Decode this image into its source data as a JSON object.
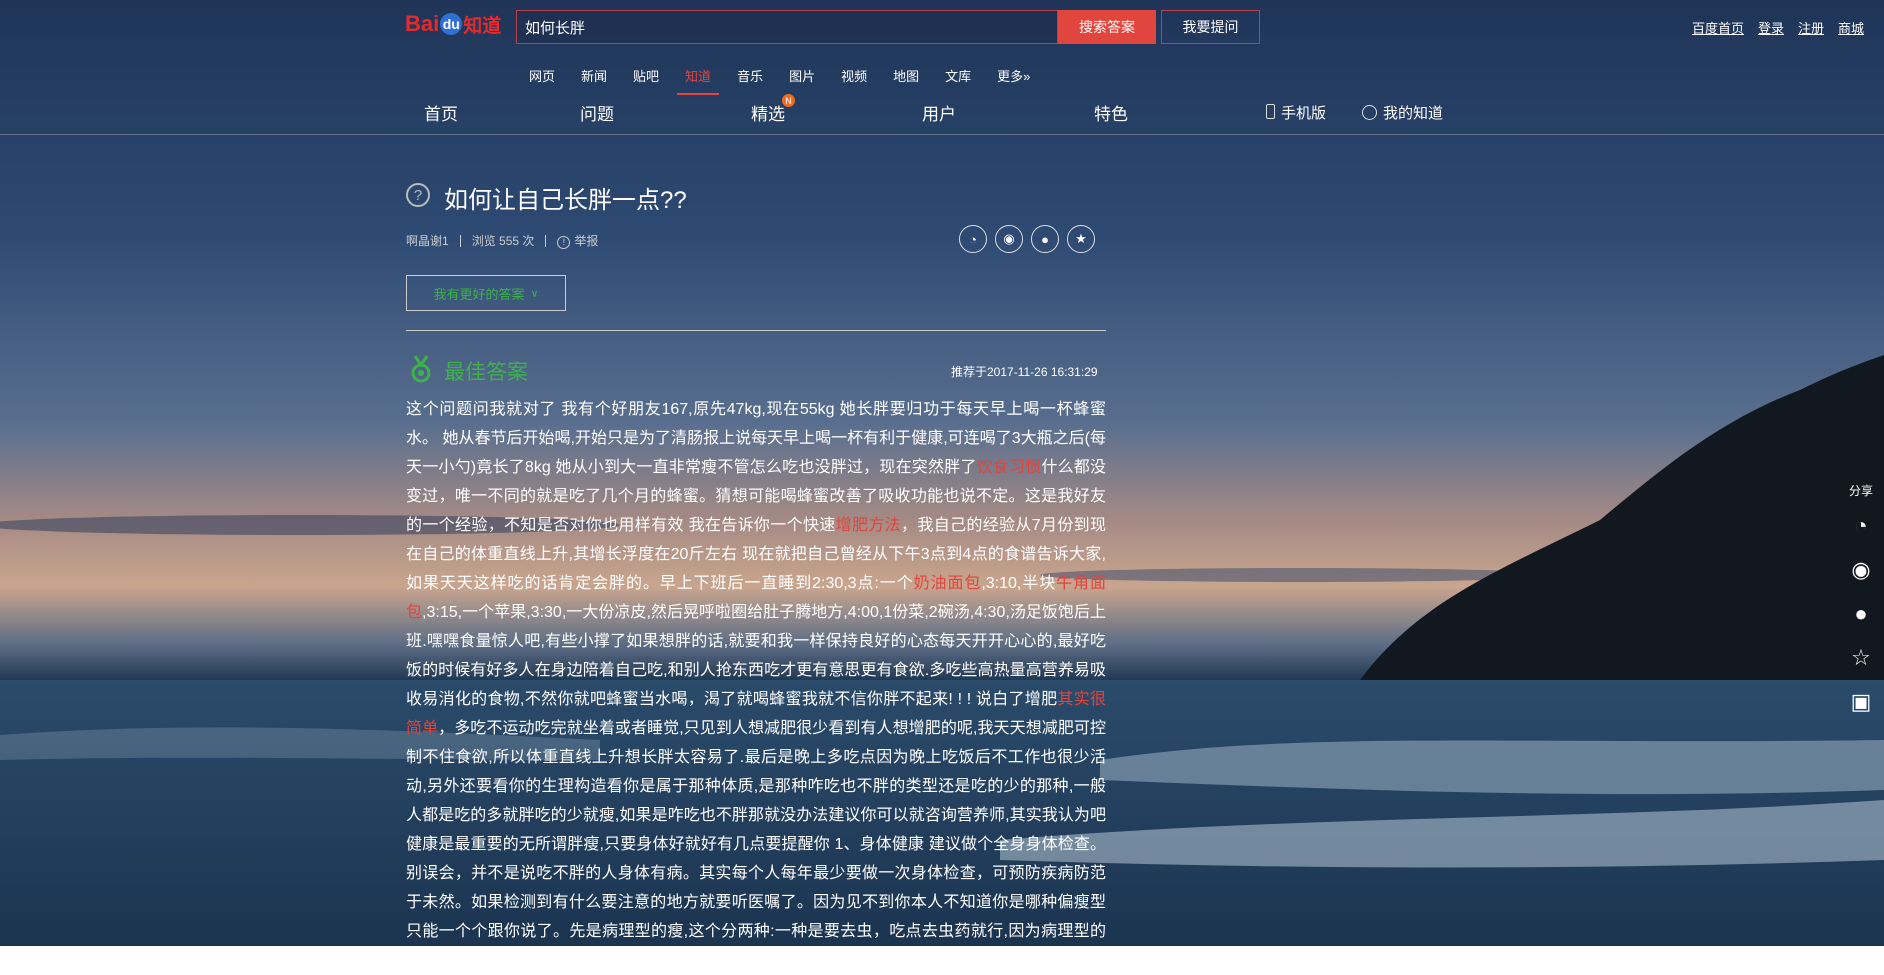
{
  "header": {
    "logo": {
      "bai": "Bai",
      "du": "du",
      "zhidao": "知道"
    },
    "search": {
      "value": "如何长胖",
      "button": "搜索答案"
    },
    "ask_button": "我要提问",
    "top_links": [
      "百度首页",
      "登录",
      "注册",
      "商城"
    ]
  },
  "channel_nav": [
    {
      "label": "网页"
    },
    {
      "label": "新闻"
    },
    {
      "label": "贴吧"
    },
    {
      "label": "知道",
      "active": true
    },
    {
      "label": "音乐"
    },
    {
      "label": "图片"
    },
    {
      "label": "视频"
    },
    {
      "label": "地图"
    },
    {
      "label": "文库"
    },
    {
      "label": "更多»"
    }
  ],
  "main_nav": {
    "home": "首页",
    "questions": "问题",
    "featured": "精选",
    "featured_badge": "N",
    "users": "用户",
    "special": "特色",
    "mobile": "手机版",
    "my_zhidao": "我的知道"
  },
  "question": {
    "title": "如何让自己长胖一点??",
    "asker": "啊晶谢1",
    "views": "浏览 555 次",
    "report": "举报",
    "better_answer_button": "我有更好的答案"
  },
  "best_answer": {
    "label": "最佳答案",
    "recommended_time": "推荐于2017-11-26 16:31:29",
    "segments": [
      {
        "t": "这个问题问我就对了 我有个好朋友167,原先47kg,现在55kg 她长胖要归功于每天早上喝一杯蜂蜜水。 她从春节后开始喝,开始只是为了清肠报上说每天早上喝一杯有利于健康,可连喝了3大瓶之后(每天一小勺)竟长了8kg 她从小到大一直非常瘦不管怎么吃也没胖过，现在突然胖了"
      },
      {
        "t": "饮食习惯",
        "kw": true
      },
      {
        "t": "什么都没变过，唯一不同的就是吃了几个月的蜂蜜。猜想可能喝蜂蜜改善了吸收功能也说不定。这是我好友的一个经验，不知是否对你也用样有效 我在告诉你一个快速"
      },
      {
        "t": "增肥方法",
        "kw": true
      },
      {
        "t": "，我自己的经验从7月份到现在自己的体重直线上升,其增长浮度在20斤左右 现在就把自己曾经从下午3点到4点的食谱告诉大家,如果天天这样吃的话肯定会胖的。早上下班后一直睡到2:30,3点:一个"
      },
      {
        "t": "奶油面包",
        "kw": true
      },
      {
        "t": ",3:10,半块"
      },
      {
        "t": "牛角面包",
        "kw": true
      },
      {
        "t": ",3:15,一个苹果,3:30,一大份凉皮,然后晃呼啦圈给肚子腾地方,4:00,1份菜,2碗汤,4:30,汤足饭饱后上班.嘿嘿食量惊人吧,有些小撑了如果想胖的话,就要和我一样保持良好的心态每天开开心心的,最好吃饭的时候有好多人在身边陪着自己吃,和别人抢东西吃才更有意思更有食欲.多吃些高热量高营养易吸收易消化的食物,不然你就吧蜂蜜当水喝，渴了就喝蜂蜜我就不信你胖不起来! ! !  说白了增肥"
      },
      {
        "t": "其实很简单",
        "kw": true
      },
      {
        "t": "，多吃不运动吃完就坐着或者睡觉,只见到人想减肥很少看到有人想增肥的呢,我天天想减肥可控制不住食欲,所以体重直线上升想长胖太容易了.最后是晚上多吃点因为晚上吃饭后不工作也很少活动,另外还要看你的生理构造看你是属于那种体质,是那种咋吃也不胖的类型还是吃的少的那种,一般人都是吃的多就胖吃的少就瘦,如果是咋吃也不胖那就没办法建议你可以就咨询营养师,其实我认为吧健康是最重要的无所谓胖瘦,只要身体好就好有几点要提醒你 1、身体健康  建议做个全身身体检查。别误会，并不是说吃不胖的人身体有病。其实每个人每年最少要做一次身体检查，可预防疾病防范于未然。如果检测到有什么要注意的地方就要听医嘱了。因为见不到你本人不知道你是哪种偏瘦型只能一个个跟你说了。先是病理型的瘦,这个分两种:一种是要去虫，吃点去虫药就行,因为病理型的可能身"
      }
    ]
  },
  "side_share": {
    "label": "分享",
    "icons": [
      "wechat-icon",
      "weibo-icon",
      "qq-icon",
      "favorite-icon",
      "clipboard-icon"
    ]
  },
  "colors": {
    "accent": "#e0453e",
    "best_answer_green": "#3db24b",
    "badge_orange": "#f06a1d"
  }
}
